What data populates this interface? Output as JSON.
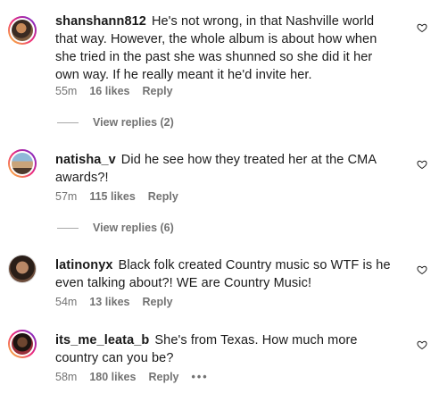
{
  "comments": [
    {
      "username": "shanshann812",
      "text": "He's not wrong, in that Nashville world that way. However, the whole album is about how when she tried in the past she was shunned so she did it her own way. If he really meant it he'd invite her.",
      "time": "55m",
      "likes": "16 likes",
      "reply": "Reply",
      "view_replies": "View replies (2)"
    },
    {
      "username": "natisha_v",
      "text": "Did he see how they treated her at the CMA awards?!",
      "time": "57m",
      "likes": "115 likes",
      "reply": "Reply",
      "view_replies": "View replies (6)"
    },
    {
      "username": "latinonyx",
      "text": "Black folk created Country music so WTF is he even talking about?! WE are Country Music!",
      "time": "54m",
      "likes": "13 likes",
      "reply": "Reply"
    },
    {
      "username": "its_me_leata_b",
      "text": "She's from Texas. How much more country can you be?",
      "time": "58m",
      "likes": "180 likes",
      "reply": "Reply",
      "more": "•••"
    }
  ]
}
